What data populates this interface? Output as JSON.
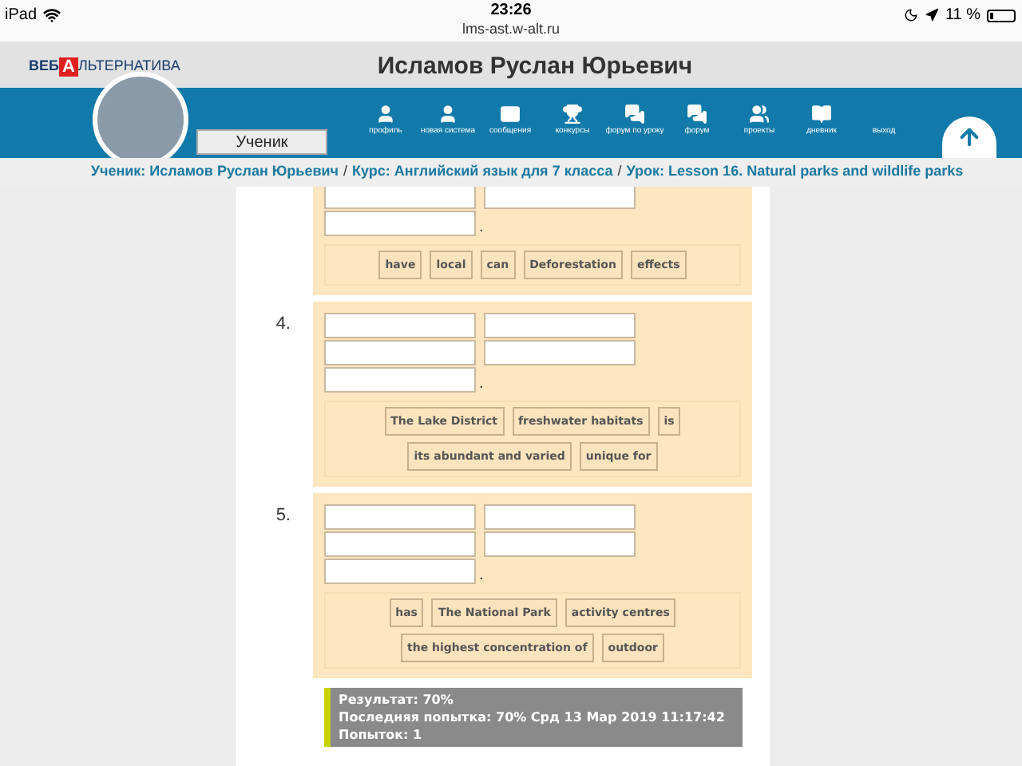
{
  "status_bar": {
    "device": "iPad",
    "time": "23:26",
    "url": "lms-ast.w-alt.ru",
    "battery": "11 %"
  },
  "logo": {
    "prefix": "ВЕБ",
    "letter": "А",
    "suffix": "ЛЬТЕРНАТИВА"
  },
  "user_name": "Исламов Руслан Юрьевич",
  "role": "Ученик",
  "nav": [
    {
      "label": "профиль",
      "kind": "user"
    },
    {
      "label": "новая система",
      "kind": "user"
    },
    {
      "label": "сообщения",
      "kind": "mail"
    },
    {
      "label": "конкурсы",
      "kind": "trophy"
    },
    {
      "label": "форум по уроку",
      "kind": "chat"
    },
    {
      "label": "форум",
      "kind": "chat"
    },
    {
      "label": "проекты",
      "kind": "group"
    },
    {
      "label": "дневник",
      "kind": "book"
    },
    {
      "label": "выход",
      "kind": "none"
    }
  ],
  "breadcrumb_separator": "/",
  "breadcrumb": [
    "Ученик: Исламов Руслан Юрьевич",
    "Курс: Английский язык для 7 класса",
    "Урок: Lesson 16. Natural parks and wildlife parks"
  ],
  "exercises": [
    {
      "end_mark": ".",
      "words": [
        [
          "have",
          "local",
          "can",
          "Deforestation",
          "effects"
        ]
      ]
    },
    {
      "number": "4.",
      "end_mark": ".",
      "words": [
        [
          "The Lake District",
          "freshwater habitats",
          "is"
        ],
        [
          "its abundant and varied",
          "unique for"
        ]
      ]
    },
    {
      "number": "5.",
      "end_mark": ".",
      "words": [
        [
          "has",
          "The National Park",
          "activity centres"
        ],
        [
          "the highest concentration of",
          "outdoor"
        ]
      ]
    }
  ],
  "result": [
    "Результат: 70%",
    "Последняя попытка: 70% Срд 13 Мар 2019 11:17:42",
    "Попыток: 1"
  ]
}
